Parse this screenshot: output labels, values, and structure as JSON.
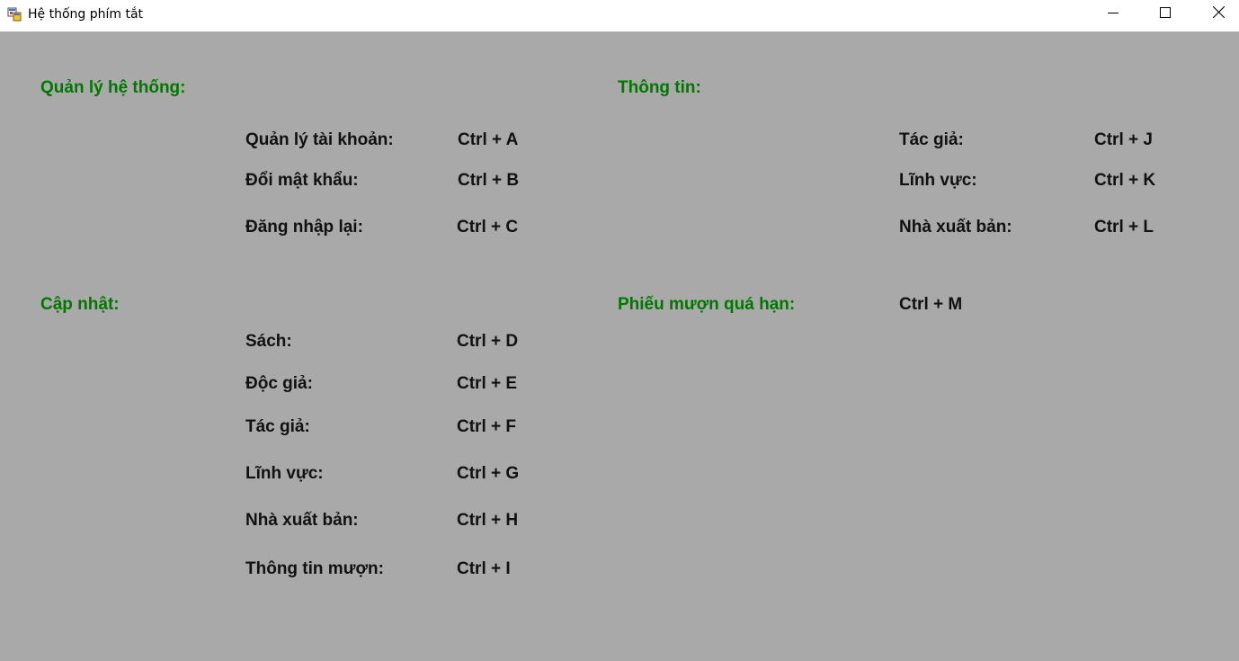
{
  "window": {
    "title": "Hệ thống phím tắt",
    "controls": [
      "minimize-icon",
      "maximize-icon",
      "close-icon"
    ]
  },
  "colors": {
    "background": "#a9a9a9",
    "heading": "#007800",
    "text": "#111111"
  },
  "sections": {
    "system": {
      "heading": "Quản lý hệ thống:",
      "items": [
        {
          "label": "Quản lý tài khoản:",
          "shortcut": "Ctrl + A"
        },
        {
          "label": "Đổi mật khẩu:",
          "shortcut": "Ctrl + B"
        },
        {
          "label": "Đăng nhập lại:",
          "shortcut": "Ctrl + C"
        }
      ]
    },
    "update": {
      "heading": "Cập nhật:",
      "items": [
        {
          "label": "Sách:",
          "shortcut": "Ctrl + D"
        },
        {
          "label": "Độc giả:",
          "shortcut": "Ctrl + E"
        },
        {
          "label": "Tác giả:",
          "shortcut": "Ctrl + F"
        },
        {
          "label": "Lĩnh vực:",
          "shortcut": "Ctrl + G"
        },
        {
          "label": "Nhà xuất bản:",
          "shortcut": "Ctrl + H"
        },
        {
          "label": "Thông tin mượn:",
          "shortcut": "Ctrl + I"
        }
      ]
    },
    "info": {
      "heading": "Thông tin:",
      "items": [
        {
          "label": "Tác giả:",
          "shortcut": "Ctrl + J"
        },
        {
          "label": "Lĩnh vực:",
          "shortcut": "Ctrl + K"
        },
        {
          "label": "Nhà xuất bản:",
          "shortcut": "Ctrl + L"
        }
      ]
    },
    "overdue": {
      "heading": "Phiếu mượn quá hạn:",
      "shortcut": "Ctrl + M"
    }
  }
}
